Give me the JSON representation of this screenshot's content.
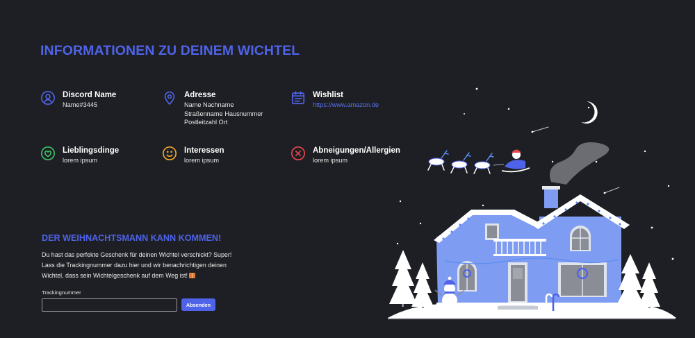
{
  "header": {
    "title": "INFORMATIONEN ZU DEINEM WICHTEL"
  },
  "info": [
    {
      "label": "Discord Name",
      "lines": [
        "Name#3445"
      ],
      "icon": "user-circle-icon",
      "color": "#4f63e9"
    },
    {
      "label": "Adresse",
      "lines": [
        "Name Nachname",
        "Straßenname Hausnummer",
        "Postleitzahl Ort"
      ],
      "icon": "map-pin-icon",
      "color": "#4f63e9"
    },
    {
      "label": "Wishlist",
      "lines": [
        "https://www.amazon.de"
      ],
      "icon": "calendar-list-icon",
      "color": "#4f63e9"
    },
    {
      "label": "Lieblingsdinge",
      "lines": [
        "lorem ipsum"
      ],
      "icon": "heart-circle-icon",
      "color": "#3fbf63"
    },
    {
      "label": "Interessen",
      "lines": [
        "lorem ipsum"
      ],
      "icon": "smiley-icon",
      "color": "#f0a630"
    },
    {
      "label": "Abneigungen/Allergien",
      "lines": [
        "lorem ipsum"
      ],
      "icon": "x-circle-icon",
      "color": "#e5484d"
    }
  ],
  "tracking": {
    "title": "DER WEIHNACHTSMANN KANN KOMMEN!",
    "intro": "Du hast das perfekte Geschenk für deinen Wichtel verschickt? Super! Lass die Trackingnummer dazu hier und wir benachrichtigen deinen Wichtel, dass sein Wichtelgeschenk auf dem Weg ist!",
    "field_label": "Trackingnummer",
    "input_value": "",
    "button_label": "Absenden"
  },
  "colors": {
    "background": "#1d1f24",
    "accent": "#4f63e9",
    "house": "#7e9cf2"
  }
}
